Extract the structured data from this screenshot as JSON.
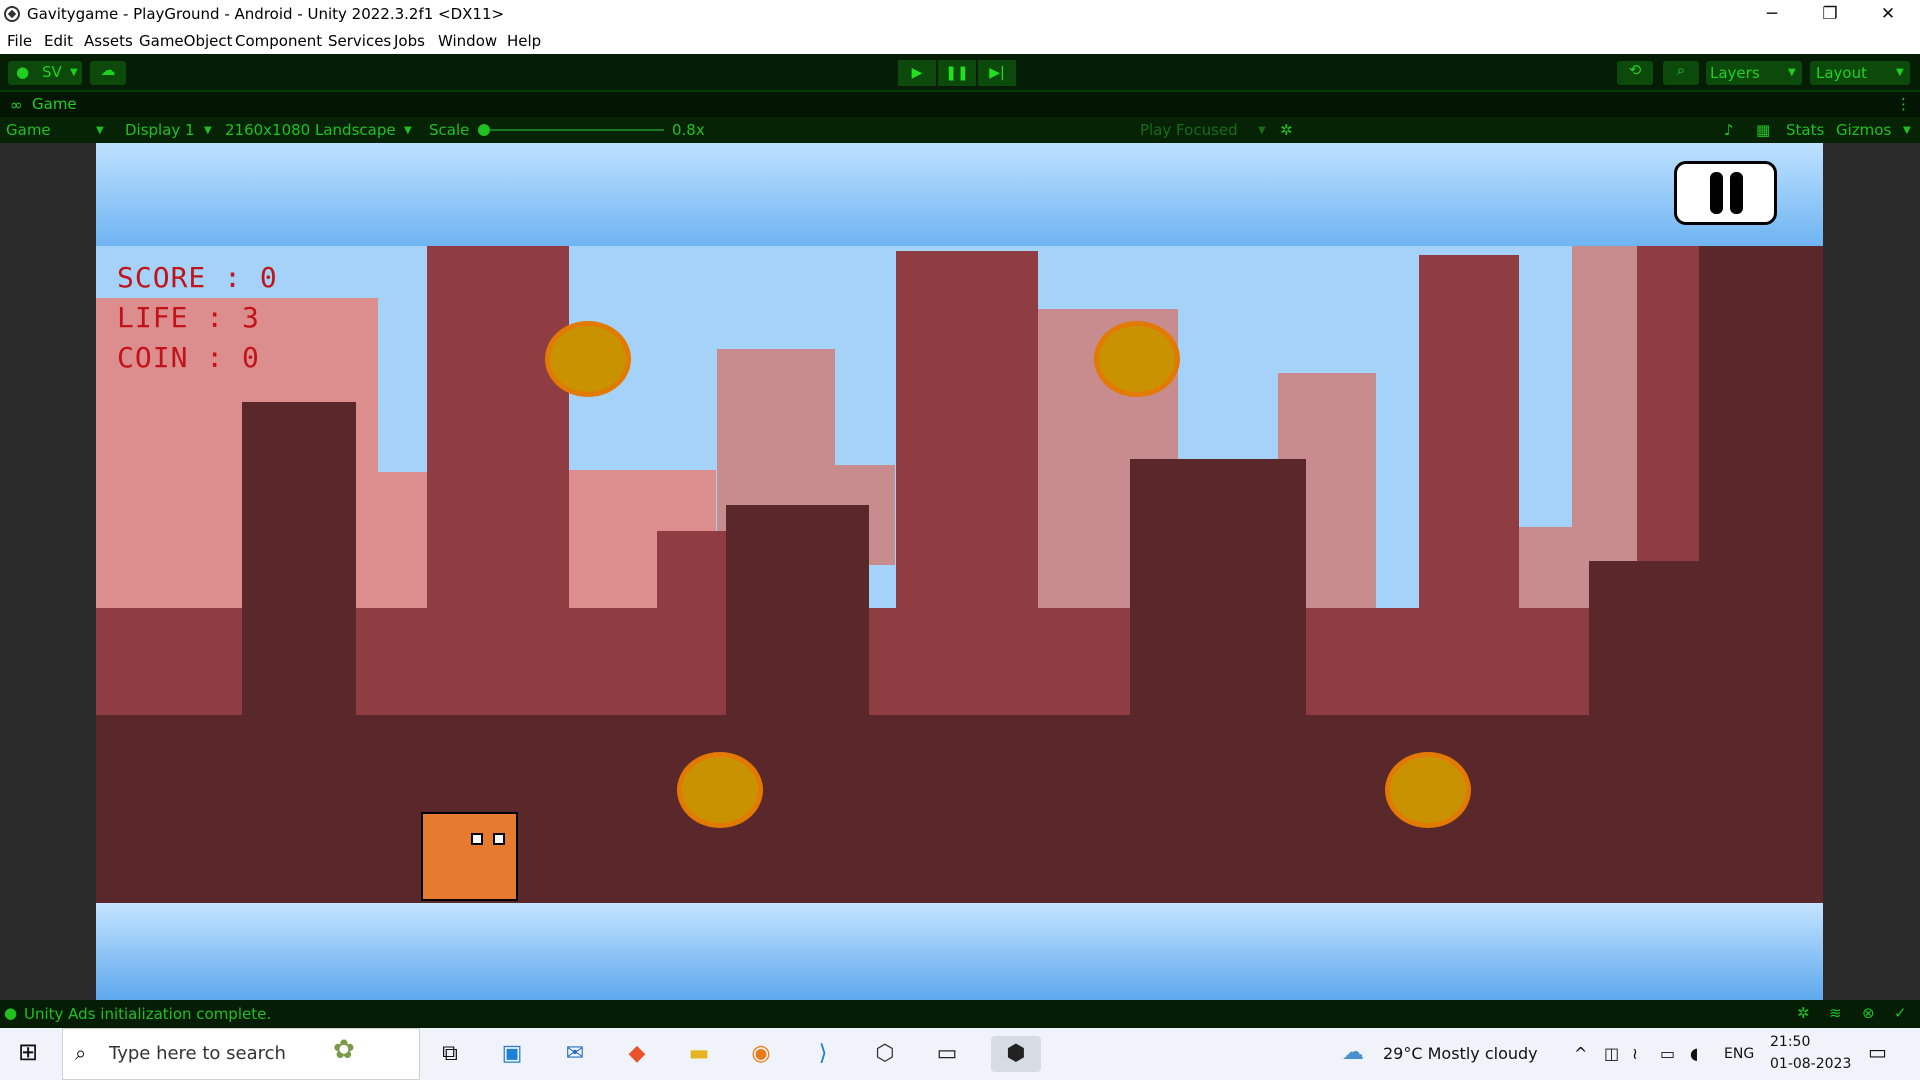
{
  "window": {
    "title": "Gavitygame - PlayGround - Android - Unity 2022.3.2f1 <DX11>",
    "minimize": "─",
    "restore": "❐",
    "close": "✕"
  },
  "menu": [
    "File",
    "Edit",
    "Assets",
    "GameObject",
    "Component",
    "Services",
    "Jobs",
    "Window",
    "Help"
  ],
  "toolbar": {
    "account": "SV",
    "play": "▶",
    "pause": "❚❚",
    "step": "▶|",
    "layers": "Layers",
    "layout": "Layout",
    "accent_color": "#20d020"
  },
  "game_tab": {
    "tab_label": "Game",
    "view_dropdown": "Game",
    "display": "Display 1",
    "resolution": "2160x1080 Landscape",
    "scale_label": "Scale",
    "scale_value": "0.8x",
    "play_focused": "Play Focused",
    "stats": "Stats",
    "gizmos": "Gizmos"
  },
  "hud": {
    "score": "SCORE : 0",
    "life": "LIFE : 3",
    "coin": "COIN : 0"
  },
  "status": {
    "message": "Unity Ads initialization complete."
  },
  "taskbar": {
    "search_placeholder": "Type here to search",
    "weather": "29°C  Mostly cloudy",
    "language": "ENG",
    "time": "21:50",
    "date": "01-08-2023"
  }
}
